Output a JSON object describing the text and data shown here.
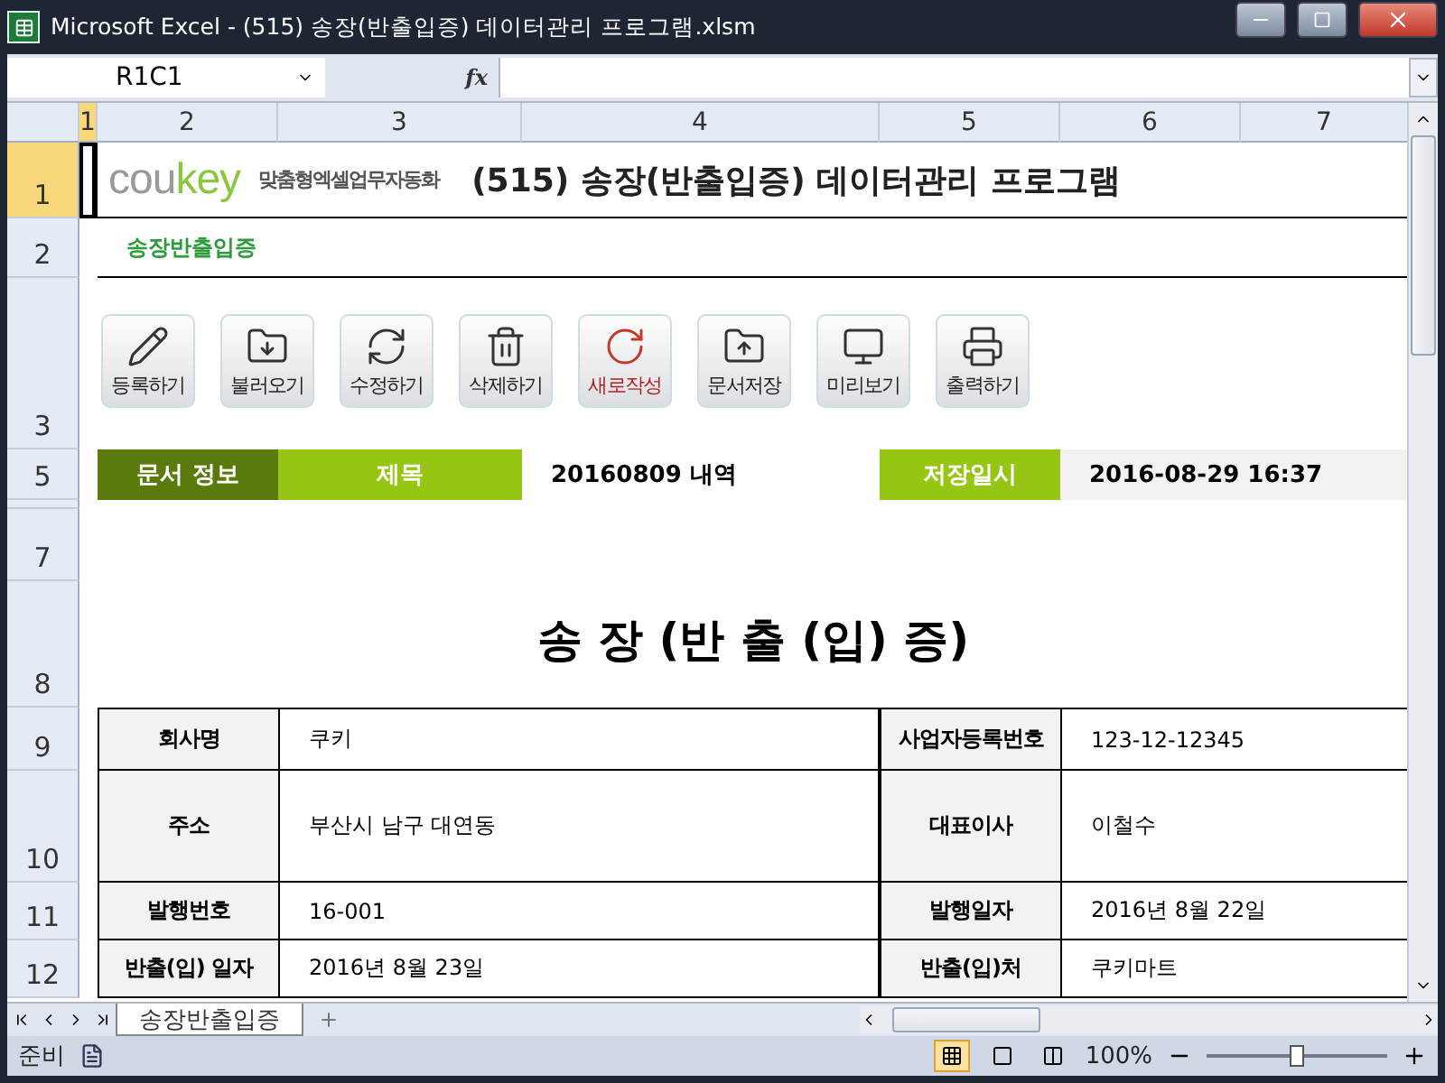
{
  "window": {
    "title": "Microsoft Excel - (515) 송장(반출입증) 데이터관리 프로그램.xlsm"
  },
  "formula_bar": {
    "name_box": "R1C1",
    "fx": "fx"
  },
  "column_headers": [
    {
      "label": "1",
      "selected": true
    },
    {
      "label": "2",
      "selected": false
    },
    {
      "label": "3",
      "selected": false
    },
    {
      "label": "4",
      "selected": false
    },
    {
      "label": "5",
      "selected": false
    },
    {
      "label": "6",
      "selected": false
    },
    {
      "label": "7",
      "selected": false
    }
  ],
  "row_headers": [
    {
      "label": "1",
      "selected": true
    },
    {
      "label": "2",
      "selected": false
    },
    {
      "label": "3",
      "selected": false
    },
    {
      "label": "5",
      "selected": false
    },
    {
      "label": "7",
      "selected": false
    },
    {
      "label": "8",
      "selected": false
    },
    {
      "label": "9",
      "selected": false
    },
    {
      "label": "10",
      "selected": false
    },
    {
      "label": "11",
      "selected": false
    },
    {
      "label": "12",
      "selected": false
    }
  ],
  "header": {
    "logo_prefix": "cou",
    "logo_suffix": "key",
    "tagline": "맞춤형엑셀업무자동화",
    "title": "(515) 송장(반출입증) 데이터관리 프로그램",
    "subtitle": "송장반출입증"
  },
  "buttons": [
    {
      "label": "등록하기",
      "kind": "register",
      "highlighted": false
    },
    {
      "label": "불러오기",
      "kind": "load",
      "highlighted": false
    },
    {
      "label": "수정하기",
      "kind": "modify",
      "highlighted": false
    },
    {
      "label": "삭제하기",
      "kind": "delete",
      "highlighted": false
    },
    {
      "label": "새로작성",
      "kind": "new",
      "highlighted": true
    },
    {
      "label": "문서저장",
      "kind": "save",
      "highlighted": false
    },
    {
      "label": "미리보기",
      "kind": "preview",
      "highlighted": false
    },
    {
      "label": "출력하기",
      "kind": "print",
      "highlighted": false
    }
  ],
  "info_bar": {
    "section": "문서 정보",
    "title_label": "제목",
    "title_value": "20160809 내역",
    "date_label": "저장일시",
    "date_value": "2016-08-29 16:37"
  },
  "document_title": "송 장 (반 출 (입) 증)",
  "fields": [
    {
      "label": "회사명",
      "value": "쿠키",
      "label2": "사업자등록번호",
      "value2": "123-12-12345"
    },
    {
      "label": "주소",
      "value": "부산시 남구 대연동",
      "label2": "대표이사",
      "value2": "이철수"
    },
    {
      "label": "발행번호",
      "value": "16-001",
      "label2": "발행일자",
      "value2": "2016년 8월 22일"
    },
    {
      "label": "반출(입) 일자",
      "value": "2016년 8월 23일",
      "label2": "반출(입)처",
      "value2": "쿠키마트"
    }
  ],
  "sheet_tabs": [
    {
      "label": "송장반출입증",
      "selected": true
    }
  ],
  "status_bar": {
    "status": "준비",
    "zoom": "100%",
    "zoom_slider": {
      "level": 0.5
    }
  }
}
